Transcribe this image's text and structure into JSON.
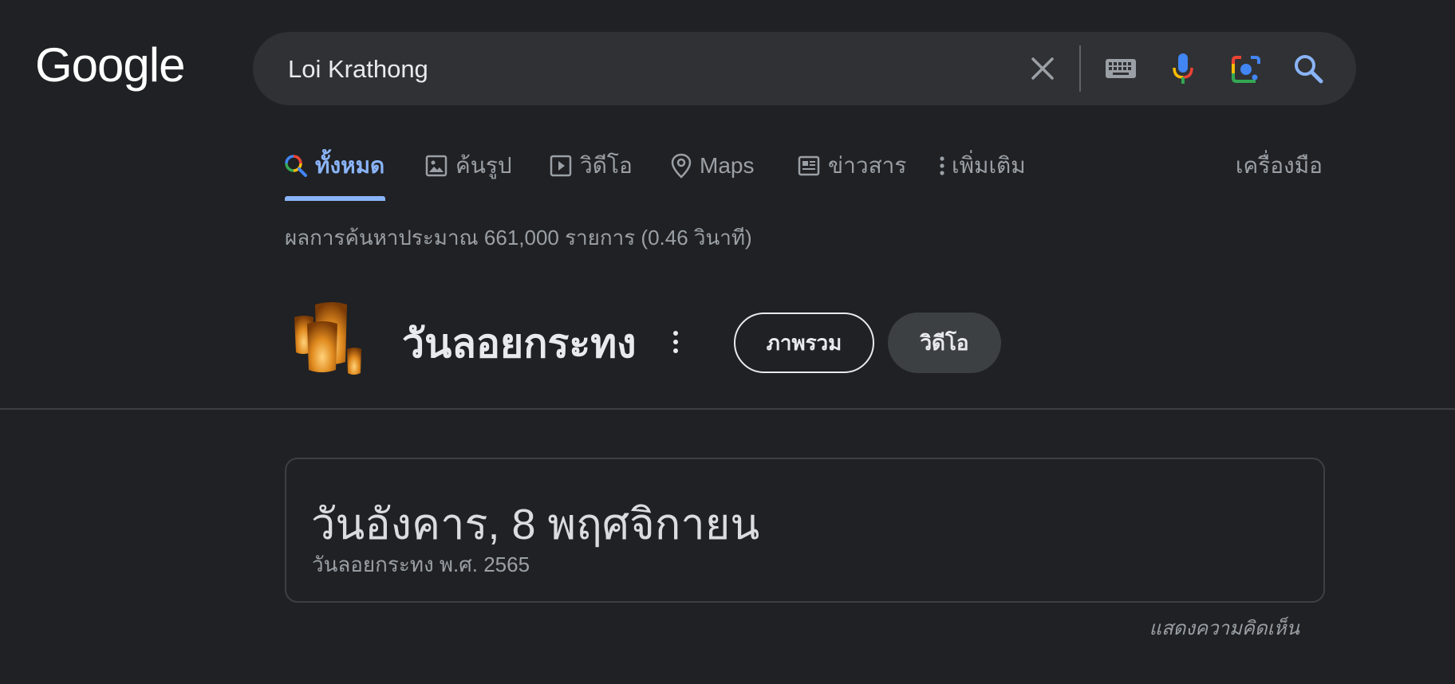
{
  "logo": "Google",
  "search": {
    "query": "Loi Krathong"
  },
  "tabs": [
    {
      "label": "ทั้งหมด",
      "icon": "search-multicolor-icon",
      "active": true
    },
    {
      "label": "ค้นรูป",
      "icon": "image-icon"
    },
    {
      "label": "วิดีโอ",
      "icon": "play-icon"
    },
    {
      "label": "Maps",
      "icon": "location-pin-icon"
    },
    {
      "label": "ข่าวสาร",
      "icon": "news-icon"
    },
    {
      "label": "เพิ่มเติม",
      "icon": "more-vert-icon"
    }
  ],
  "tools_label": "เครื่องมือ",
  "stats": "ผลการค้นหาประมาณ 661,000 รายการ (0.46 วินาที)",
  "entity": {
    "title": "วันลอยกระทง",
    "chips": [
      "ภาพรวม",
      "วิดีโอ"
    ]
  },
  "answer_card": {
    "date": "วันอังคาร, 8 พฤศจิกายน",
    "subtitle": "วันลอยกระทง พ.ศ. 2565"
  },
  "feedback": "แสดงความคิดเห็น",
  "colors": {
    "background": "#202124",
    "accent": "#8ab4f8",
    "searchbox": "#303134"
  }
}
